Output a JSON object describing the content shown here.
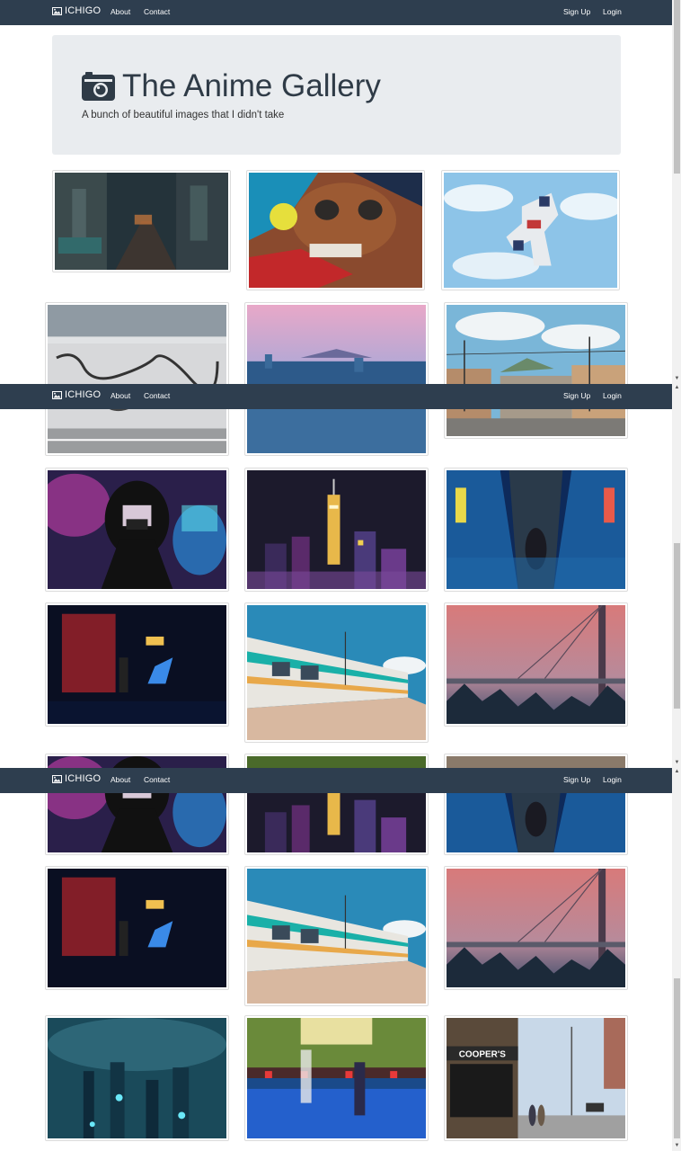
{
  "nav": {
    "brand": "ICHIGO",
    "about": "About",
    "contact": "Contact",
    "signup": "Sign Up",
    "login": "Login"
  },
  "jumbotron": {
    "title": "The Anime Gallery",
    "subtitle": "A bunch of beautiful images that I didn't take"
  },
  "images": [
    {
      "name": "neon-street-night-image"
    },
    {
      "name": "graffiti-anime-face-image"
    },
    {
      "name": "gundam-statue-sky-image"
    },
    {
      "name": "graffiti-wall-image"
    },
    {
      "name": "city-skyline-dusk-image"
    },
    {
      "name": "street-power-lines-image"
    },
    {
      "name": "neon-girl-mask-image"
    },
    {
      "name": "tower-night-city-image"
    },
    {
      "name": "neon-escalator-image"
    },
    {
      "name": "red-arcade-image"
    },
    {
      "name": "train-platform-image"
    },
    {
      "name": "foggy-bridge-image"
    },
    {
      "name": "foggy-city-lights-image"
    },
    {
      "name": "bowling-alley-image"
    },
    {
      "name": "coopers-street-image"
    }
  ],
  "storefront_sign": "COOPER'S",
  "colors": {
    "navbar": "#2e3e4f",
    "jumbotron": "#e9ecef",
    "title_text": "#2f3b47"
  },
  "icons": {
    "brand": "picture-icon",
    "title": "camera-icon"
  }
}
